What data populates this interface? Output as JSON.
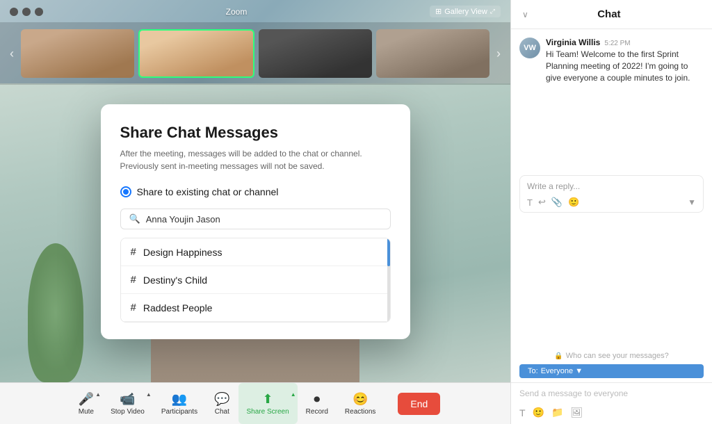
{
  "app": {
    "title": "Zoom"
  },
  "top_bar": {
    "title": "Zoom",
    "gallery_view": "Gallery View"
  },
  "thumbnails": [
    {
      "id": "person-1",
      "style": "person-1"
    },
    {
      "id": "person-2",
      "style": "person-2",
      "active": true
    },
    {
      "id": "person-3",
      "style": "person-3"
    },
    {
      "id": "person-4",
      "style": "person-4"
    }
  ],
  "modal": {
    "title": "Share Chat Messages",
    "description": "After the meeting, messages will be added to the chat or channel. Previously sent in-meeting messages will not be saved.",
    "radio_option": "Share to existing chat or channel",
    "search_placeholder": "Anna Youjin Jason",
    "channels": [
      {
        "name": "Design Happiness"
      },
      {
        "name": "Destiny's Child"
      },
      {
        "name": "Raddest People"
      }
    ]
  },
  "toolbar": {
    "items": [
      {
        "id": "mute",
        "label": "Mute",
        "icon": "🎤",
        "has_arrow": true
      },
      {
        "id": "stop-video",
        "label": "Stop Video",
        "icon": "📹",
        "has_arrow": true
      },
      {
        "id": "participants",
        "label": "Participants",
        "icon": "👥",
        "has_arrow": false
      },
      {
        "id": "chat",
        "label": "Chat",
        "icon": "💬",
        "has_arrow": false
      },
      {
        "id": "share-screen",
        "label": "Share Screen",
        "icon": "⬆",
        "has_arrow": true,
        "active": true
      },
      {
        "id": "record",
        "label": "Record",
        "icon": "⏺",
        "has_arrow": false
      },
      {
        "id": "reactions",
        "label": "Reactions",
        "icon": "😊",
        "has_arrow": false
      }
    ],
    "end_label": "End"
  },
  "chat_panel": {
    "title": "Chat",
    "messages": [
      {
        "author": "Virginia Willis",
        "time": "5:22 PM",
        "text": "Hi Team! Welcome to the first Sprint Planning meeting of 2022! I'm going to give everyone a couple minutes to join.",
        "avatar_initials": "VW"
      }
    ],
    "reply_placeholder": "Write a reply...",
    "who_sees": "Who can see your messages?",
    "to_label": "To: Everyone ▼",
    "message_placeholder": "Send a message to everyone"
  }
}
